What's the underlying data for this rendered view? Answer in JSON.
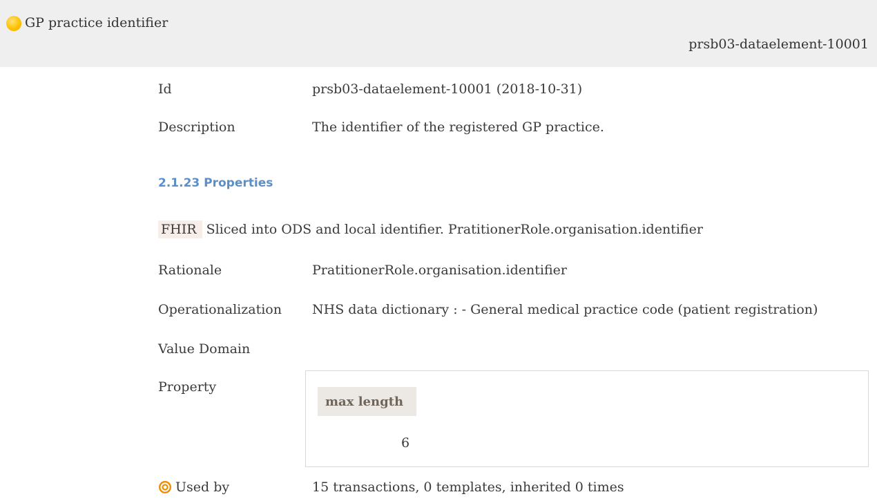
{
  "header": {
    "title": "GP practice identifier",
    "identifier": "prsb03-dataelement-10001",
    "status_icon": "sun-status-icon"
  },
  "rows": {
    "id": {
      "label": "Id",
      "value": "prsb03-dataelement-10001 (2018-10-31)"
    },
    "description": {
      "label": "Description",
      "value": "The identifier of the registered GP practice."
    }
  },
  "properties_section": {
    "heading": "2.1.23 Properties",
    "fhir_tag": "FHIR",
    "fhir_text": "Sliced into ODS and local identifier. PratitionerRole.organisation.identifier"
  },
  "details": {
    "rationale": {
      "label": "Rationale",
      "value": "PratitionerRole.organisation.identifier"
    },
    "operationalization": {
      "label": "Operationalization",
      "value": "NHS data dictionary : - General medical practice code (patient registration)"
    },
    "value_domain": {
      "label": "Value Domain"
    },
    "property": {
      "label": "Property",
      "column_header": "max length",
      "column_value": "6"
    }
  },
  "used_by": {
    "icon": "target-icon",
    "label": "Used by",
    "value": "15 transactions, 0 templates, inherited 0 times"
  },
  "colors": {
    "header_bg": "#efefef",
    "heading_blue": "#5a8fc9",
    "fhir_tag_bg": "#f7ede9",
    "property_header_bg": "#ece9e4",
    "target_orange": "#f28c00"
  }
}
